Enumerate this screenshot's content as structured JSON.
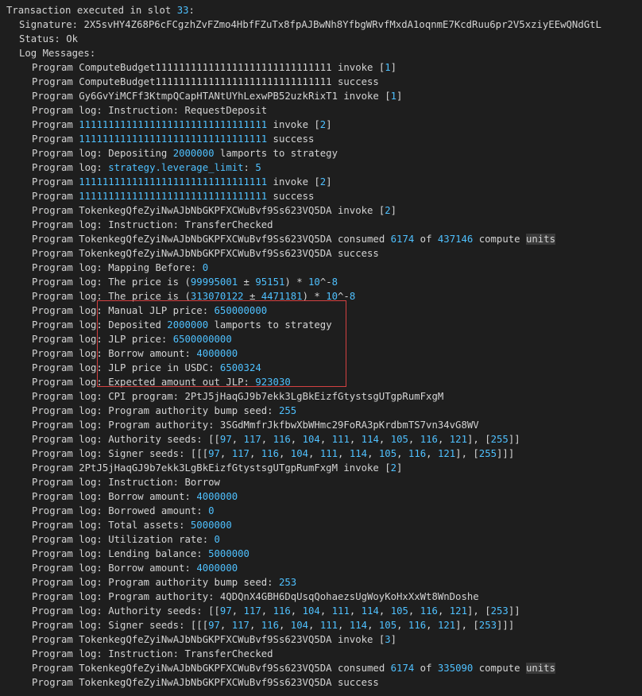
{
  "header": {
    "prefix": "Transaction executed in slot ",
    "slot": "33",
    "suffix": ":"
  },
  "sig": {
    "label": "Signature: ",
    "value": "2X5svHY4Z68P6cFCgzhZvFZmo4HbfFZuTx8fpAJBwNh8YfbgWRvfMxdA1oqnmE7KcdRuu6pr2V5xziyEEwQNdGtL"
  },
  "status": "Status: Ok",
  "logHeader": "Log Messages:",
  "p": "Program ",
  "pl": "Program log: ",
  "ids": {
    "compute": "ComputeBudget111111111111111111111111111111",
    "user": "Gy6GvYiMCFf3KtmpQCapHTANtUYhLexwPB52uzkRixT1",
    "sys": "11111111111111111111111111111111",
    "token": "TokenkegQfeZyiNwAJbNbGKPFXCWuBvf9Ss623VQ5DA",
    "lend": "2PtJ5jHaqGJ9b7ekk3LgBkEizfGtystsgUTgpRumFxgM"
  },
  "tokens": {
    "invoke": " invoke [",
    "close": "]",
    "success": " success",
    "consumed": " consumed ",
    "of": " of ",
    "compute": " compute ",
    "units": "units"
  },
  "lines": {
    "l1n": "1",
    "l3n": "1",
    "instrReqDep": "Instruction: RequestDeposit",
    "l4n": "2",
    "depPrefix": "Depositing ",
    "depAmt": "2000000",
    "depSuffix": " lamports to strategy",
    "levLabel": "strategy.leverage_limit",
    "levSep": ": ",
    "levVal": "5",
    "l7n": "2",
    "tokInv": "2",
    "instrTC": "Instruction: TransferChecked",
    "cons1a": "6174",
    "cons1b": "437146",
    "mapBeforeL": "Mapping Before: ",
    "mapBeforeV": "0",
    "price1a": "The price is (",
    "p1v1": "99995001",
    "pm": " ± ",
    "p1v2": "95151",
    "p1c": ") * ",
    "p1t": "10",
    "p1e": "^-",
    "p1x": "8",
    "p2v1": "313070122",
    "p2v2": "4471181",
    "p2x": "8",
    "mjlpL": "Manual JLP price: ",
    "mjlpV": "650000000",
    "dep2P": "Deposited ",
    "dep2A": "2000000",
    "dep2S": " lamports to strategy",
    "jlpPL": "JLP price: ",
    "jlpPV": "6500000000",
    "borL": "Borrow amount: ",
    "borV": "4000000",
    "jlpUL": "JLP price in USDC: ",
    "jlpUV": "6500324",
    "expL": "Expected amount out JLP: ",
    "expV": "923030",
    "cpiL": "CPI program: ",
    "cpiV": "2PtJ5jHaqGJ9b7ekk3LgBkEizfGtystsgUTgpRumFxgM",
    "bumpL": "Program authority bump seed: ",
    "bump1": "255",
    "authL": "Program authority: ",
    "auth1": "3SGdMmfrJkfbwXbWHmc29FoRA3pKrdbmTS7vn34vG8WV",
    "aseedsL": "Authority seeds: [[",
    "s97": "97",
    "s117": "117",
    "s116": "116",
    "s104": "104",
    "s111": "111",
    "s114": "114",
    "s105": "105",
    "s121": "121",
    "sClose": "], [",
    "sEnd": "]]",
    "sseedsL": "Signer seeds: [[[",
    "sEnd3": "]]]",
    "lendInv": "2",
    "instrBor": "Instruction: Borrow",
    "borAL": "Borrow amount: ",
    "borAV": "4000000",
    "boredL": "Borrowed amount: ",
    "boredV": "0",
    "totAL": "Total assets: ",
    "totAV": "5000000",
    "utilL": "Utilization rate: ",
    "utilV": "0",
    "lendBL": "Lending balance: ",
    "lendBV": "5000000",
    "borA2V": "4000000",
    "bump2": "253",
    "auth2": "4QDQnX4GBH6DqUsqQohaezsUgWoyKoHxXxWt8WnDoshe",
    "s253": "253",
    "tokInv2": "3",
    "cons2a": "6174",
    "cons2b": "335090"
  },
  "comma": ", "
}
